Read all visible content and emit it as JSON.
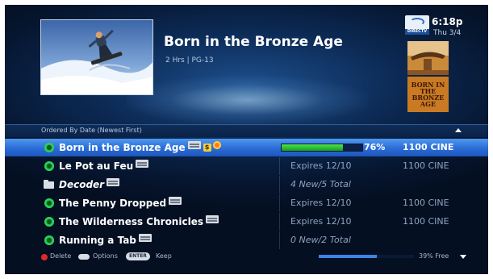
{
  "program": {
    "title": "Born in the Bronze Age",
    "meta": "2 Hrs | PG-13"
  },
  "status_bar": {
    "time": "6:18p",
    "date": "Thu 3/4",
    "logo_text": "DIRECTV",
    "poster_text": "BORN IN THE BRONZE AGE"
  },
  "list": {
    "sort_label": "Ordered By Date (Newest First)",
    "rows": [
      {
        "name": "Born in the Bronze Age",
        "info": "",
        "progress": "76%",
        "progress_value": 0.76,
        "channel": "1100 CINE",
        "icons": [
          "hd-icon",
          "dollar-icon",
          "status-dot-icon"
        ]
      },
      {
        "name": "Le Pot au Feu",
        "info": "Expires 12/10",
        "channel": "1100 CINE",
        "icons": [
          "hd-icon"
        ]
      },
      {
        "name": "Decoder",
        "info": "4 New/5 Total",
        "channel": "",
        "icons": [
          "hd-icon"
        ]
      },
      {
        "name": "The Penny Dropped",
        "info": "Expires 12/10",
        "channel": "1100 CINE",
        "icons": [
          "hd-icon"
        ]
      },
      {
        "name": "The Wilderness Chronicles",
        "info": "Expires 12/10",
        "channel": "1100 CINE",
        "icons": [
          "hd-icon"
        ]
      },
      {
        "name": "Running a Tab",
        "info": "0 New/2 Total",
        "channel": "",
        "icons": [
          "hd-icon"
        ]
      }
    ]
  },
  "footer": {
    "delete": "Delete",
    "options": "Options",
    "enter_key": "ENTER",
    "keep": "Keep",
    "disk_free": "39% Free",
    "disk_used_fraction": 0.61
  },
  "colors": {
    "selected_row": "#2a6cd6",
    "progress_fill": "#16a020",
    "status_green": "#27b24a",
    "background": "#0c2a55"
  }
}
